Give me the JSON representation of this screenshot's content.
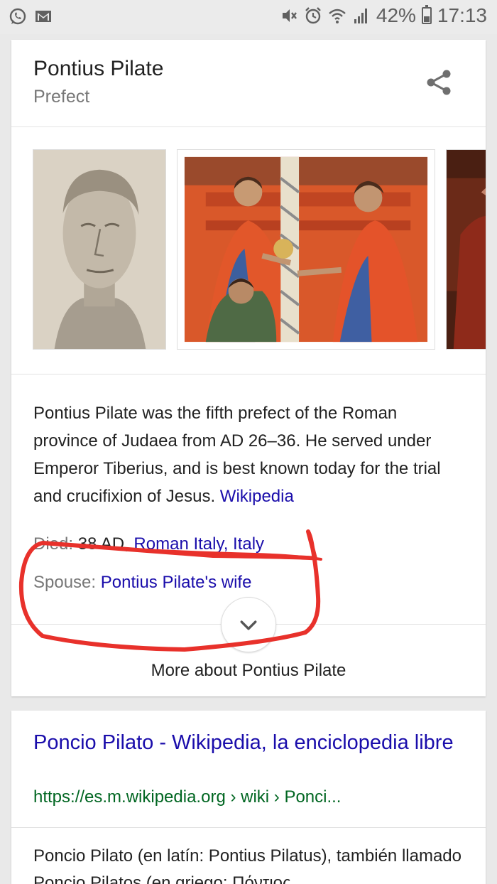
{
  "status_bar": {
    "battery_percent": "42%",
    "time": "17:13",
    "icons": [
      "whatsapp-icon",
      "gmail-icon",
      "mute-icon",
      "alarm-icon",
      "wifi-icon",
      "signal-icon",
      "battery-icon"
    ]
  },
  "knowledge_panel": {
    "title": "Pontius Pilate",
    "subtitle": "Prefect",
    "share_icon": "share-icon",
    "images": [
      "roman-bust-image",
      "duccio-painting-image",
      "painting-image-partial"
    ],
    "description": "Pontius Pilate was the fifth prefect of the Roman province of Judaea from AD 26–36. He served under Emperor Tiberius, and is best known today for the trial and crucifixion of Jesus.",
    "description_source": "Wikipedia",
    "facts": {
      "died_label": "Died:",
      "died_value": "38 AD,",
      "died_place": "Roman Italy, Italy",
      "spouse_label": "Spouse:",
      "spouse_value": "Pontius Pilate's wife"
    },
    "expand_icon": "chevron-down-icon",
    "more_label": "More about Pontius Pilate"
  },
  "annotation": {
    "color": "#e8312b"
  },
  "result": {
    "title": "Poncio Pilato - Wikipedia, la enciclopedia libre",
    "url": "https://es.m.wikipedia.org › wiki › Ponci...",
    "snippet": "Poncio Pilato (en latín: Pontius Pilatus), también llamado Poncio Pilatos (en griego: Πόντιος"
  }
}
